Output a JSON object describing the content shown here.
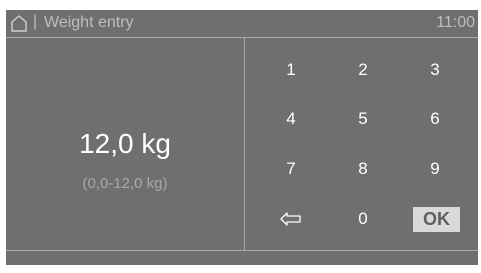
{
  "header": {
    "separator": "|",
    "title": "Weight entry",
    "time": "11:00"
  },
  "display": {
    "value": "12,0 kg",
    "range": "(0,0-12,0 kg)"
  },
  "keypad": {
    "k1": "1",
    "k2": "2",
    "k3": "3",
    "k4": "4",
    "k5": "5",
    "k6": "6",
    "k7": "7",
    "k8": "8",
    "k9": "9",
    "k0": "0",
    "ok": "OK",
    "back_icon": "backspace-arrow-icon"
  },
  "colors": {
    "background": "#6f6f6f",
    "ok_button": "#d9d9d9"
  }
}
